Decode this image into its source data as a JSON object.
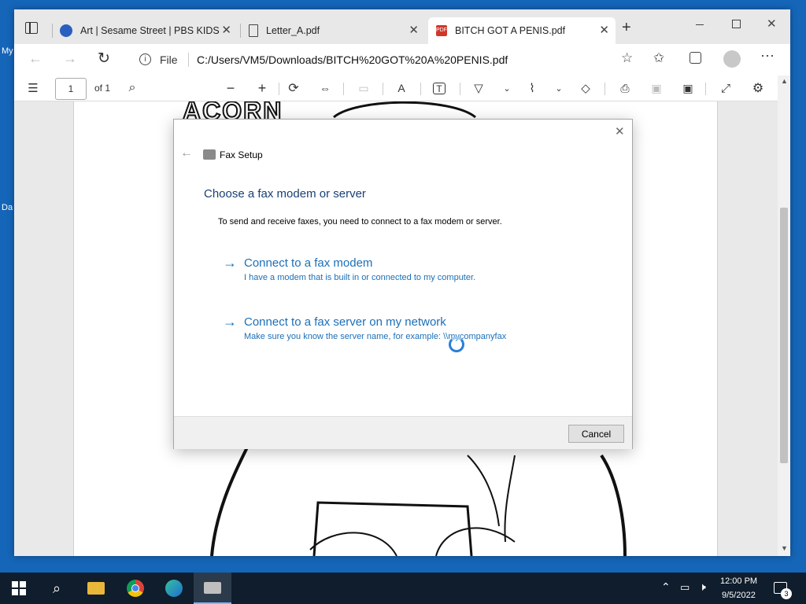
{
  "desktop": {
    "labels": [
      "My",
      "Da"
    ]
  },
  "browser": {
    "tabs": [
      {
        "title": "Art | Sesame Street | PBS KIDS",
        "icon": "pbs-kids-icon"
      },
      {
        "title": "Letter_A.pdf",
        "icon": "document-icon"
      },
      {
        "title": "BITCH GOT A PENIS.pdf",
        "icon": "pdf-icon"
      }
    ],
    "address": {
      "info_label": "File",
      "url": "C:/Users/VM5/Downloads/BITCH%20GOT%20A%20PENIS.pdf"
    },
    "pdf_toolbar": {
      "page_number": "1",
      "page_total": "of 1"
    }
  },
  "dialog": {
    "header_title": "Fax Setup",
    "heading": "Choose a fax modem or server",
    "intro": "To send and receive faxes, you need to connect to a fax modem or server.",
    "options": [
      {
        "title": "Connect to a fax modem",
        "desc": "I have a modem that is built in or connected to my computer."
      },
      {
        "title": "Connect to a fax server on my network",
        "desc": "Make sure you know the server name, for example: \\\\mycompanyfax"
      }
    ],
    "cancel_label": "Cancel"
  },
  "pdf_page": {
    "visible_word": "ACORN"
  },
  "taskbar": {
    "time": "12:00 PM",
    "date": "9/5/2022",
    "notification_count": "3"
  },
  "colors": {
    "desktop": "#1565b8",
    "link": "#1c6fb8",
    "heading": "#1a3f75",
    "taskbar": "#0f1d2c"
  }
}
